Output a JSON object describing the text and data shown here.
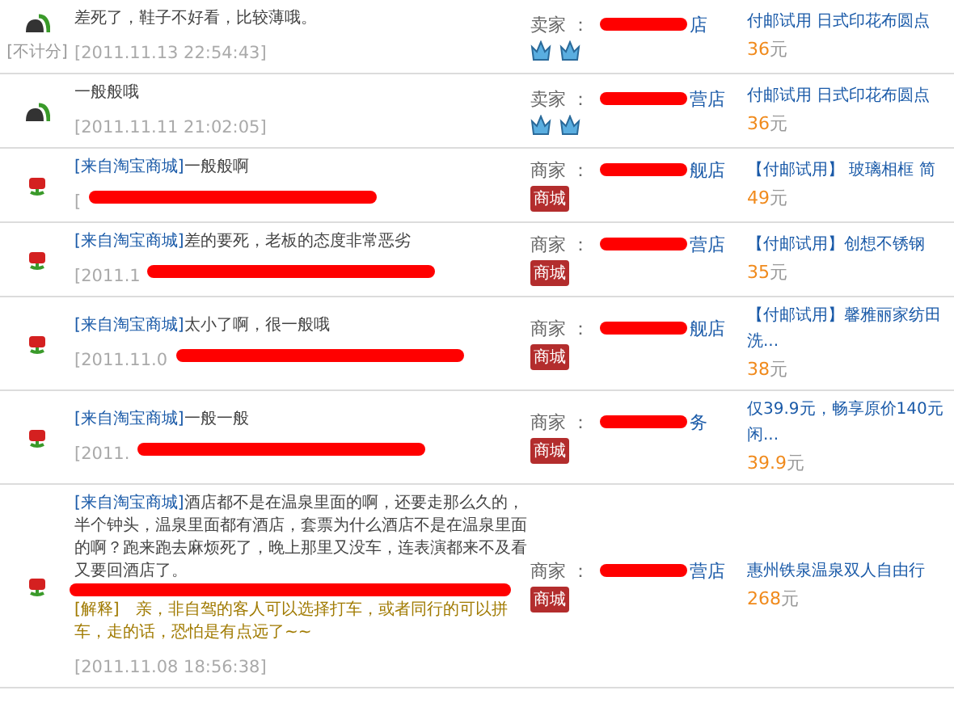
{
  "reviews": [
    {
      "kind": "gadget",
      "note": "[不计分]",
      "comment": "差死了，鞋子不好看，比较薄哦。",
      "date": "[2011.11.13 22:54:43]",
      "seller_label": "卖家 ：",
      "seller_name": "店",
      "badge": {
        "kind": "crowns",
        "items": [
          {
            "kind": "crown"
          },
          {
            "kind": "crown"
          }
        ]
      },
      "product": [
        "付邮试用 日式印花布圆点"
      ],
      "price": "36",
      "currency": "元"
    },
    {
      "kind": "gadget",
      "comment": "一般般哦",
      "date": "[2011.11.11 21:02:05]",
      "seller_label": "卖家 ：",
      "seller_name": "营店",
      "badge": {
        "kind": "crowns",
        "items": [
          {
            "kind": "crown"
          },
          {
            "kind": "crown"
          }
        ]
      },
      "product": [
        "付邮试用 日式印花布圆点"
      ],
      "price": "36",
      "currency": "元"
    },
    {
      "kind": "flower",
      "tag": "[来自淘宝商城]",
      "comment": "一般般啊",
      "date": "[",
      "date_redacted": true,
      "seller_label": "商家 ：",
      "seller_name": "舰店",
      "badge": {
        "kind": "mall",
        "label": "商城"
      },
      "product": [
        "【付邮试用】 玻璃相框 简"
      ],
      "price": "49",
      "currency": "元"
    },
    {
      "kind": "flower",
      "tag": "[来自淘宝商城]",
      "comment": "差的要死，老板的态度非常恶劣",
      "date": "[2011.1",
      "date_redacted": true,
      "seller_label": "商家 ：",
      "seller_name": "营店",
      "badge": {
        "kind": "mall",
        "label": "商城"
      },
      "product": [
        "【付邮试用】创想不锈钢"
      ],
      "price": "35",
      "currency": "元"
    },
    {
      "kind": "flower",
      "tag": "[来自淘宝商城]",
      "comment": "太小了啊，很一般哦",
      "date": "[2011.11.0",
      "date_redacted": true,
      "seller_label": "商家 ：",
      "seller_name": "舰店",
      "badge": {
        "kind": "mall",
        "label": "商城"
      },
      "product": [
        "【付邮试用】馨雅丽家纺田",
        "洗..."
      ],
      "price": "38",
      "currency": "元"
    },
    {
      "kind": "flower",
      "tag": "[来自淘宝商城]",
      "comment": "一般一般",
      "date": "[2011.",
      "date_redacted": true,
      "seller_label": "商家 ：",
      "seller_name": "务",
      "badge": {
        "kind": "mall",
        "label": "商城"
      },
      "product": [
        "仅39.9元，畅享原价140元",
        "闲..."
      ],
      "price": "39.9",
      "currency": "元"
    },
    {
      "kind": "flower",
      "tag": "[来自淘宝商城]",
      "comment": "酒店都不是在温泉里面的啊，还要走那么久的，半个钟头，温泉里面都有酒店，套票为什么酒店不是在温泉里面的啊？跑来跑去麻烦死了，晚上那里又没车，连表演都来不及看又要回酒店了。",
      "comment_redacted": true,
      "reply_label": "[解释]",
      "reply": "亲，非自驾的客人可以选择打车，或者同行的可以拼车，走的话，恐怕是有点远了~~",
      "date": "[2011.11.08 18:56:38]",
      "seller_label": "商家 ：",
      "seller_name": "营店",
      "badge": {
        "kind": "mall",
        "label": "商城"
      },
      "product": [
        "惠州铁泉温泉双人自由行"
      ],
      "price": "268",
      "currency": "元"
    }
  ]
}
